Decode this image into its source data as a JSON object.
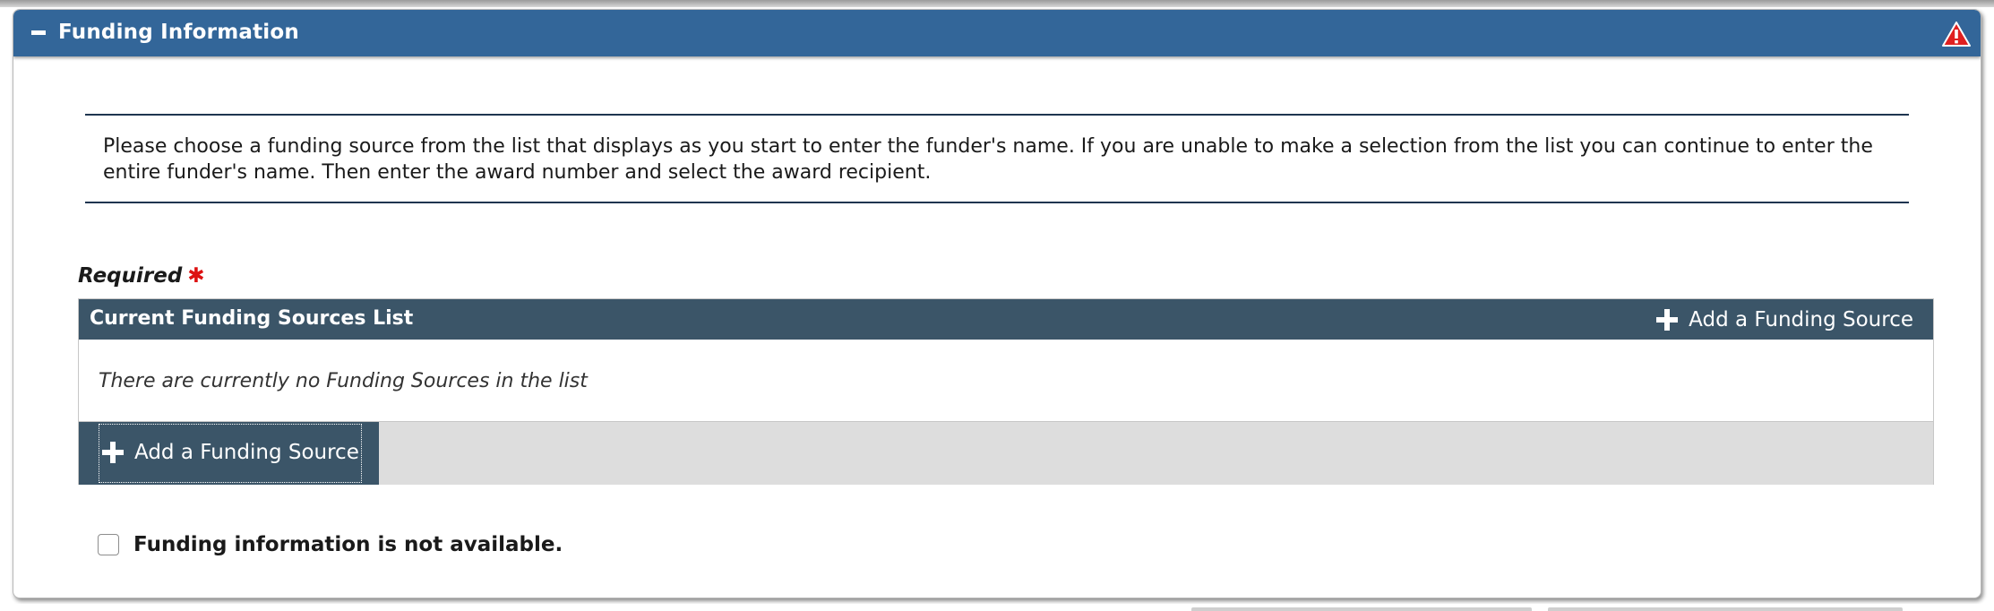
{
  "panel": {
    "title": "Funding Information",
    "header_color": "#336699",
    "collapse_icon": "minus-icon",
    "status_icon": "warning-icon"
  },
  "instructions": {
    "text": "Please choose a funding source from the list that displays as you start to enter the funder's name. If you are unable to make a selection from the list you can continue to enter the entire funder's name. Then enter the award number and select the award recipient."
  },
  "required": {
    "label": "Required",
    "marker": "✱",
    "marker_color": "#dd1111"
  },
  "funding_sources": {
    "header_title": "Current Funding Sources List",
    "header_color": "#3b5568",
    "add_top_label": "Add a Funding Source",
    "empty_message": "There are currently no Funding Sources in the list",
    "add_bottom_label": "Add a Funding Source",
    "add_icon": "plus-icon"
  },
  "not_available": {
    "label": "Funding information is not available.",
    "checked": false
  }
}
